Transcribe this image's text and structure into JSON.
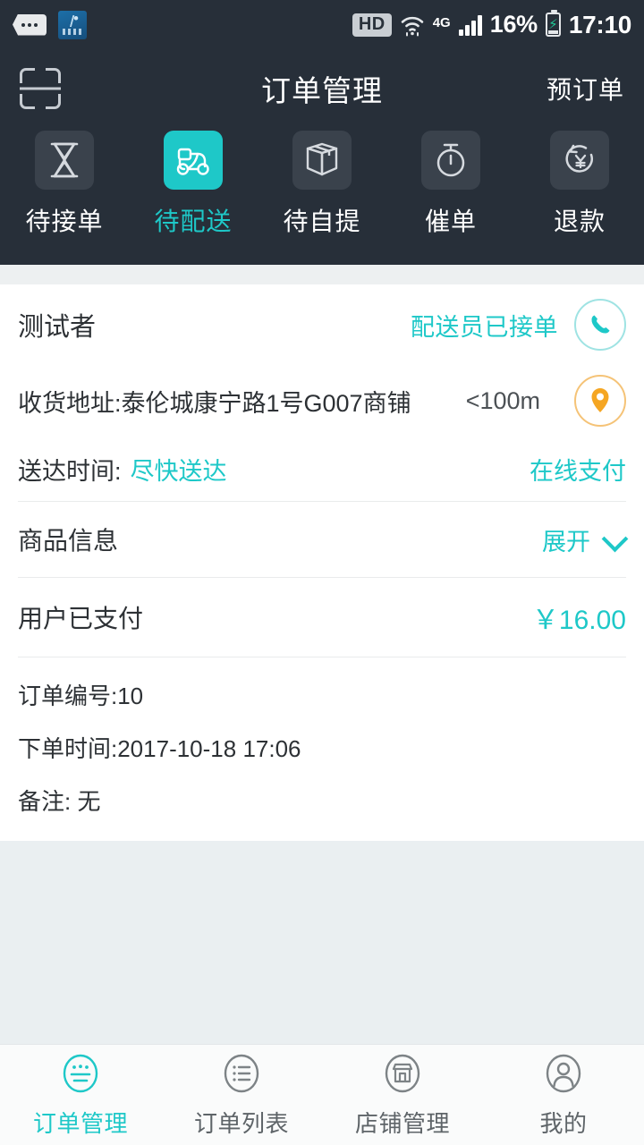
{
  "statusbar": {
    "message_icon": "message-dots-icon",
    "app_icon": "app-shortcut-icon",
    "hd_badge": "HD",
    "wifi_icon": "wifi-icon",
    "network_type": "4G",
    "signal_icon": "signal-bars-icon",
    "battery_percent": "16%",
    "battery_icon": "battery-charging-icon",
    "clock": "17:10"
  },
  "header": {
    "scan_icon": "scan-code-icon",
    "title": "订单管理",
    "action_label": "预订单"
  },
  "tabs": [
    {
      "label": "待接单",
      "icon": "hourglass-icon",
      "active": false
    },
    {
      "label": "待配送",
      "icon": "scooter-icon",
      "active": true
    },
    {
      "label": "待自提",
      "icon": "box-icon",
      "active": false
    },
    {
      "label": "催单",
      "icon": "stopwatch-icon",
      "active": false
    },
    {
      "label": "退款",
      "icon": "refund-yuan-icon",
      "active": false
    }
  ],
  "order": {
    "customer_name": "测试者",
    "delivery_status": "配送员已接单",
    "call_icon": "phone-icon",
    "address": "收货地址:泰伦城康宁路1号G007商铺",
    "distance": "<100m",
    "location_icon": "location-pin-icon",
    "delivery_time_label": "送达时间:",
    "delivery_time_value": "尽快送达",
    "payment_method": "在线支付",
    "goods_title": "商品信息",
    "expand_label": "展开",
    "expand_icon": "chevron-down-icon",
    "paid_label": "用户已支付",
    "paid_amount": "￥16.00",
    "order_no": "订单编号:10",
    "order_time": "下单时间:2017-10-18 17:06",
    "remark": "备注: 无"
  },
  "bottomnav": [
    {
      "label": "订单管理",
      "icon": "order-manage-icon",
      "active": true
    },
    {
      "label": "订单列表",
      "icon": "order-list-icon",
      "active": false
    },
    {
      "label": "店铺管理",
      "icon": "shop-icon",
      "active": false
    },
    {
      "label": "我的",
      "icon": "user-profile-icon",
      "active": false
    }
  ],
  "colors": {
    "accent_teal": "#1EC8C8",
    "header_dark": "#272F39",
    "page_bg": "#EAEFF1",
    "orange": "#F5A623",
    "text_primary": "#2D3135"
  }
}
